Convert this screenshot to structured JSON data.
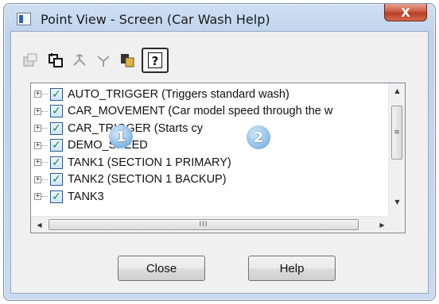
{
  "window": {
    "title": "Point View - Screen (Car Wash Help)",
    "close_glyph": "X"
  },
  "toolbar": {
    "icons": [
      "properties-icon",
      "select-point-icon",
      "tree-icon",
      "disconnect-icon",
      "copy-icon",
      "help-icon"
    ],
    "help_glyph": "?"
  },
  "tree": {
    "items": [
      {
        "label": "AUTO_TRIGGER (Triggers standard wash)",
        "checked": true
      },
      {
        "label": "CAR_MOVEMENT (Car model speed through the w",
        "checked": true
      },
      {
        "label": "CAR_TRIGGER (Starts cy",
        "checked": true
      },
      {
        "label": "DEMO_SPEED",
        "checked": true
      },
      {
        "label": "TANK1 (SECTION 1 PRIMARY)",
        "checked": true
      },
      {
        "label": "TANK2 (SECTION 1 BACKUP)",
        "checked": true
      },
      {
        "label": "TANK3",
        "checked": true
      }
    ],
    "scroll_glyphs": {
      "up": "▲",
      "down": "▼",
      "left": "◀",
      "right": "▶",
      "grip_v": "≡",
      "grip_h": "III"
    }
  },
  "callouts": [
    "1",
    "2"
  ],
  "buttons": {
    "close_label": "Close",
    "help_label": "Help"
  },
  "colors": {
    "checkbox_check": "#1f8a3c",
    "callout_fill": "#7fb5e4",
    "close_button": "#c8533b"
  }
}
